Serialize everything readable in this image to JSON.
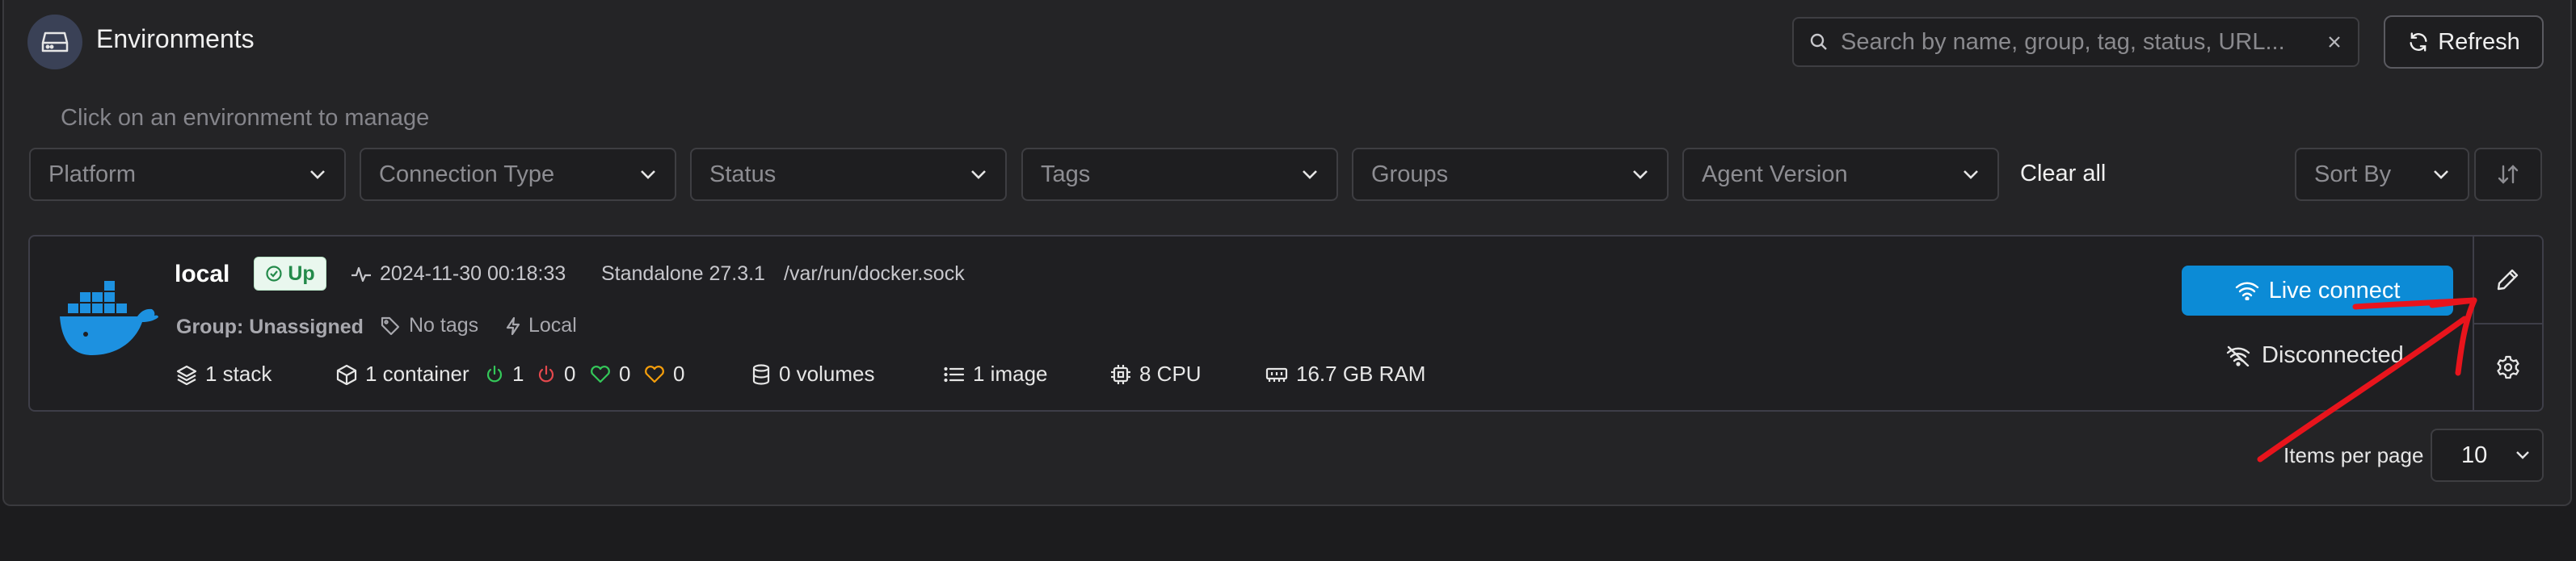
{
  "header": {
    "title": "Environments",
    "search_placeholder": "Search by name, group, tag, status, URL...",
    "refresh_label": "Refresh"
  },
  "hint": "Click on an environment to manage",
  "filters": [
    {
      "label": "Platform"
    },
    {
      "label": "Connection Type"
    },
    {
      "label": "Status"
    },
    {
      "label": "Tags"
    },
    {
      "label": "Groups"
    },
    {
      "label": "Agent Version"
    }
  ],
  "clear_all_label": "Clear all",
  "sort_by_label": "Sort By",
  "environment": {
    "name": "local",
    "status": "Up",
    "timestamp": "2024-11-30 00:18:33",
    "type": "Standalone 27.3.1",
    "url": "/var/run/docker.sock",
    "group": "Group: Unassigned",
    "tags": "No tags",
    "locality": "Local",
    "stats": {
      "stacks": "1 stack",
      "containers": "1 container",
      "running": "1",
      "stopped": "0",
      "healthy": "0",
      "unhealthy": "0",
      "volumes": "0 volumes",
      "images": "1 image",
      "cpu": "8 CPU",
      "ram": "16.7 GB RAM"
    },
    "live_connect_label": "Live connect",
    "connection_state": "Disconnected"
  },
  "pagination": {
    "items_per_page_label": "Items per page",
    "items_per_page_value": "10"
  },
  "colors": {
    "accent": "#0c8bd6",
    "up_badge_text": "#238a4a",
    "running": "#34c759",
    "stopped": "#e5484d",
    "healthy": "#34c759",
    "unhealthy": "#f59e0b",
    "annotation": "#e8141c",
    "docker_blue": "#1d91e0"
  }
}
